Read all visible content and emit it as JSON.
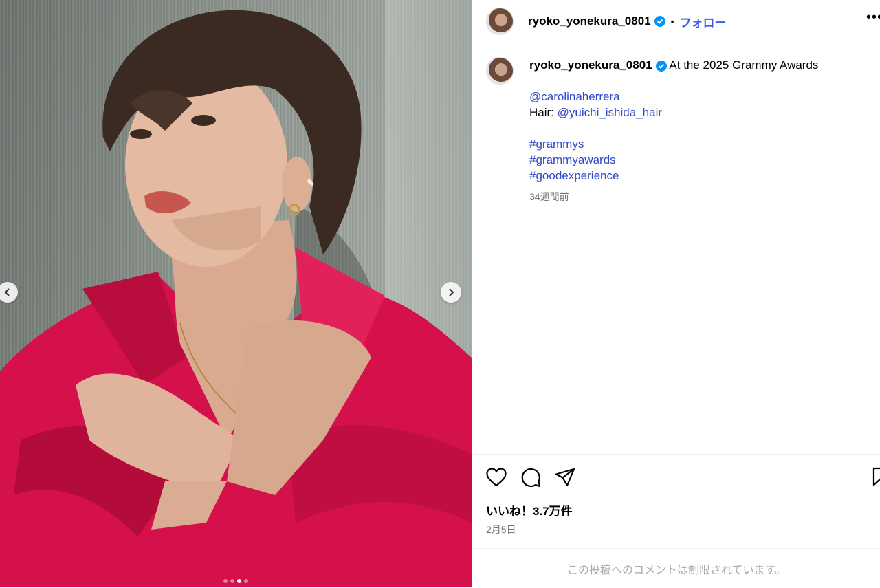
{
  "post": {
    "username": "ryoko_yonekura_0801",
    "separator": "•",
    "follow_label": "フォロー",
    "more_label": "•••"
  },
  "caption": {
    "username": "ryoko_yonekura_0801",
    "text": "At the 2025 Grammy Awards",
    "mention_brand": "@carolinaherrera",
    "hair_prefix": "Hair: ",
    "mention_hair": "@yuichi_ishida_hair",
    "hashtags": [
      "#grammys",
      "#grammyawards",
      "#goodexperience"
    ],
    "time_ago": "34週間前"
  },
  "engagement": {
    "likes": "いいね！3.7万件",
    "date": "2月5日"
  },
  "comments_notice": "この投稿へのコメントは制限されています。",
  "carousel": {
    "slide_count": 4,
    "active_index": 2
  },
  "colors": {
    "link": "#3048c9",
    "follow": "#3d5ae8",
    "verified": "#0095f6",
    "shirt": "#d4114a"
  },
  "icons": [
    "chevron-left-icon",
    "chevron-right-icon",
    "verified-badge-icon",
    "heart-icon",
    "comment-icon",
    "share-icon",
    "bookmark-icon"
  ]
}
